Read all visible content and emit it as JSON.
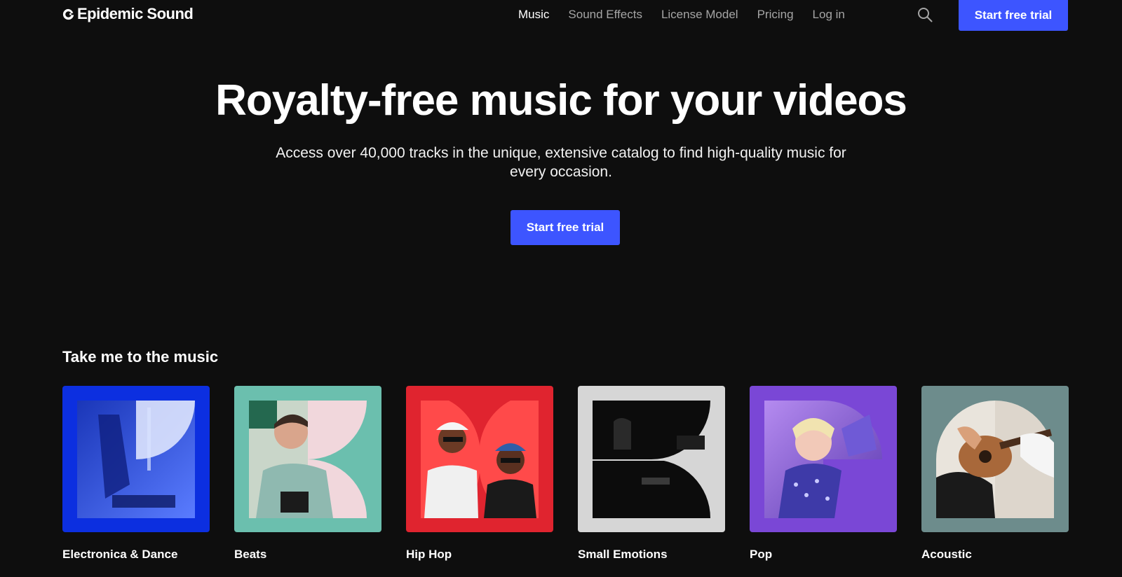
{
  "header": {
    "brand": "Epidemic Sound",
    "nav": [
      {
        "label": "Music",
        "active": true
      },
      {
        "label": "Sound Effects",
        "active": false
      },
      {
        "label": "License Model",
        "active": false
      },
      {
        "label": "Pricing",
        "active": false
      },
      {
        "label": "Log in",
        "active": false
      }
    ],
    "search_icon": "search-icon",
    "cta_label": "Start free trial"
  },
  "hero": {
    "title": "Royalty-free music for your videos",
    "subtitle": "Access over 40,000 tracks in the unique, extensive catalog to find high-quality music for every occasion.",
    "cta_label": "Start free trial"
  },
  "section": {
    "title": "Take me to the music",
    "genres": [
      {
        "label": "Electronica & Dance",
        "bg": "#0c2fe0"
      },
      {
        "label": "Beats",
        "bg": "#6bbfae"
      },
      {
        "label": "Hip Hop",
        "bg": "#e0242f"
      },
      {
        "label": "Small Emotions",
        "bg": "#d6d6d6"
      },
      {
        "label": "Pop",
        "bg": "#7a47d6"
      },
      {
        "label": "Acoustic",
        "bg": "#6d8c8c"
      }
    ]
  },
  "colors": {
    "background": "#0e0e0e",
    "accent": "#3d55ff",
    "nav_inactive": "#a5a5a5"
  }
}
